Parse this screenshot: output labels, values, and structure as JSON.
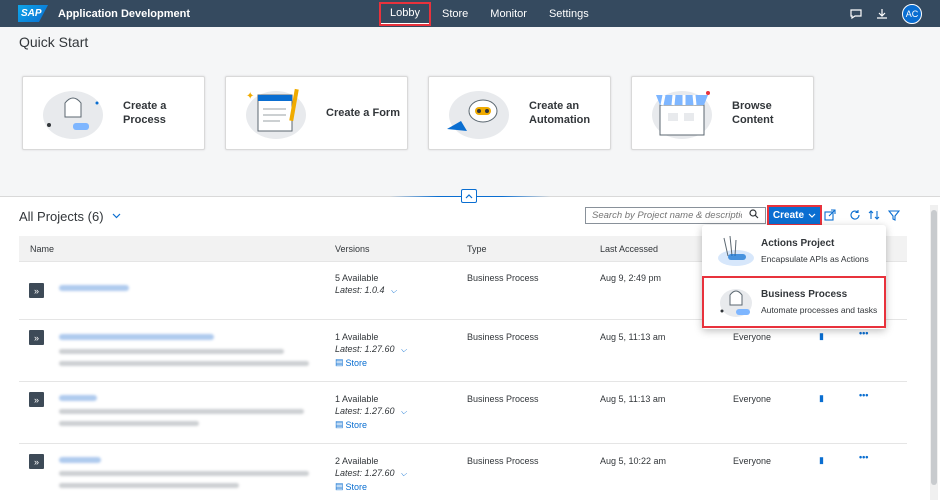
{
  "shell": {
    "logo": "SAP",
    "app_title": "Application Development",
    "nav": [
      "Lobby",
      "Store",
      "Monitor",
      "Settings"
    ],
    "active_nav": "Lobby",
    "avatar_initials": "AC"
  },
  "quick_start": {
    "title": "Quick Start",
    "cards": [
      {
        "label": "Create a Process"
      },
      {
        "label": "Create a Form"
      },
      {
        "label": "Create an Automation"
      },
      {
        "label": "Browse Content"
      }
    ]
  },
  "projects": {
    "title": "All Projects (6)",
    "search_placeholder": "Search by Project name & description",
    "create_label": "Create",
    "columns": [
      "Name",
      "Versions",
      "Type",
      "Last Accessed"
    ],
    "rows": [
      {
        "versions": "5 Available",
        "latest": "Latest: 1.0.4",
        "store": "",
        "type": "Business Process",
        "accessed": "Aug 9, 2:49 pm",
        "access": ""
      },
      {
        "versions": "1 Available",
        "latest": "Latest: 1.27.60",
        "store": "Store",
        "type": "Business Process",
        "accessed": "Aug 5, 11:13 am",
        "access": "Everyone"
      },
      {
        "versions": "1 Available",
        "latest": "Latest: 1.27.60",
        "store": "Store",
        "type": "Business Process",
        "accessed": "Aug 5, 11:13 am",
        "access": "Everyone"
      },
      {
        "versions": "2 Available",
        "latest": "Latest: 1.27.60",
        "store": "Store",
        "type": "Business Process",
        "accessed": "Aug 5, 10:22 am",
        "access": "Everyone"
      }
    ]
  },
  "create_menu": {
    "items": [
      {
        "title": "Actions Project",
        "subtitle": "Encapsulate APIs as Actions"
      },
      {
        "title": "Business Process",
        "subtitle": "Automate processes and tasks"
      }
    ]
  },
  "colors": {
    "shell_bg": "#354a5f",
    "accent": "#0a6ed1",
    "highlight": "#e8323c"
  }
}
